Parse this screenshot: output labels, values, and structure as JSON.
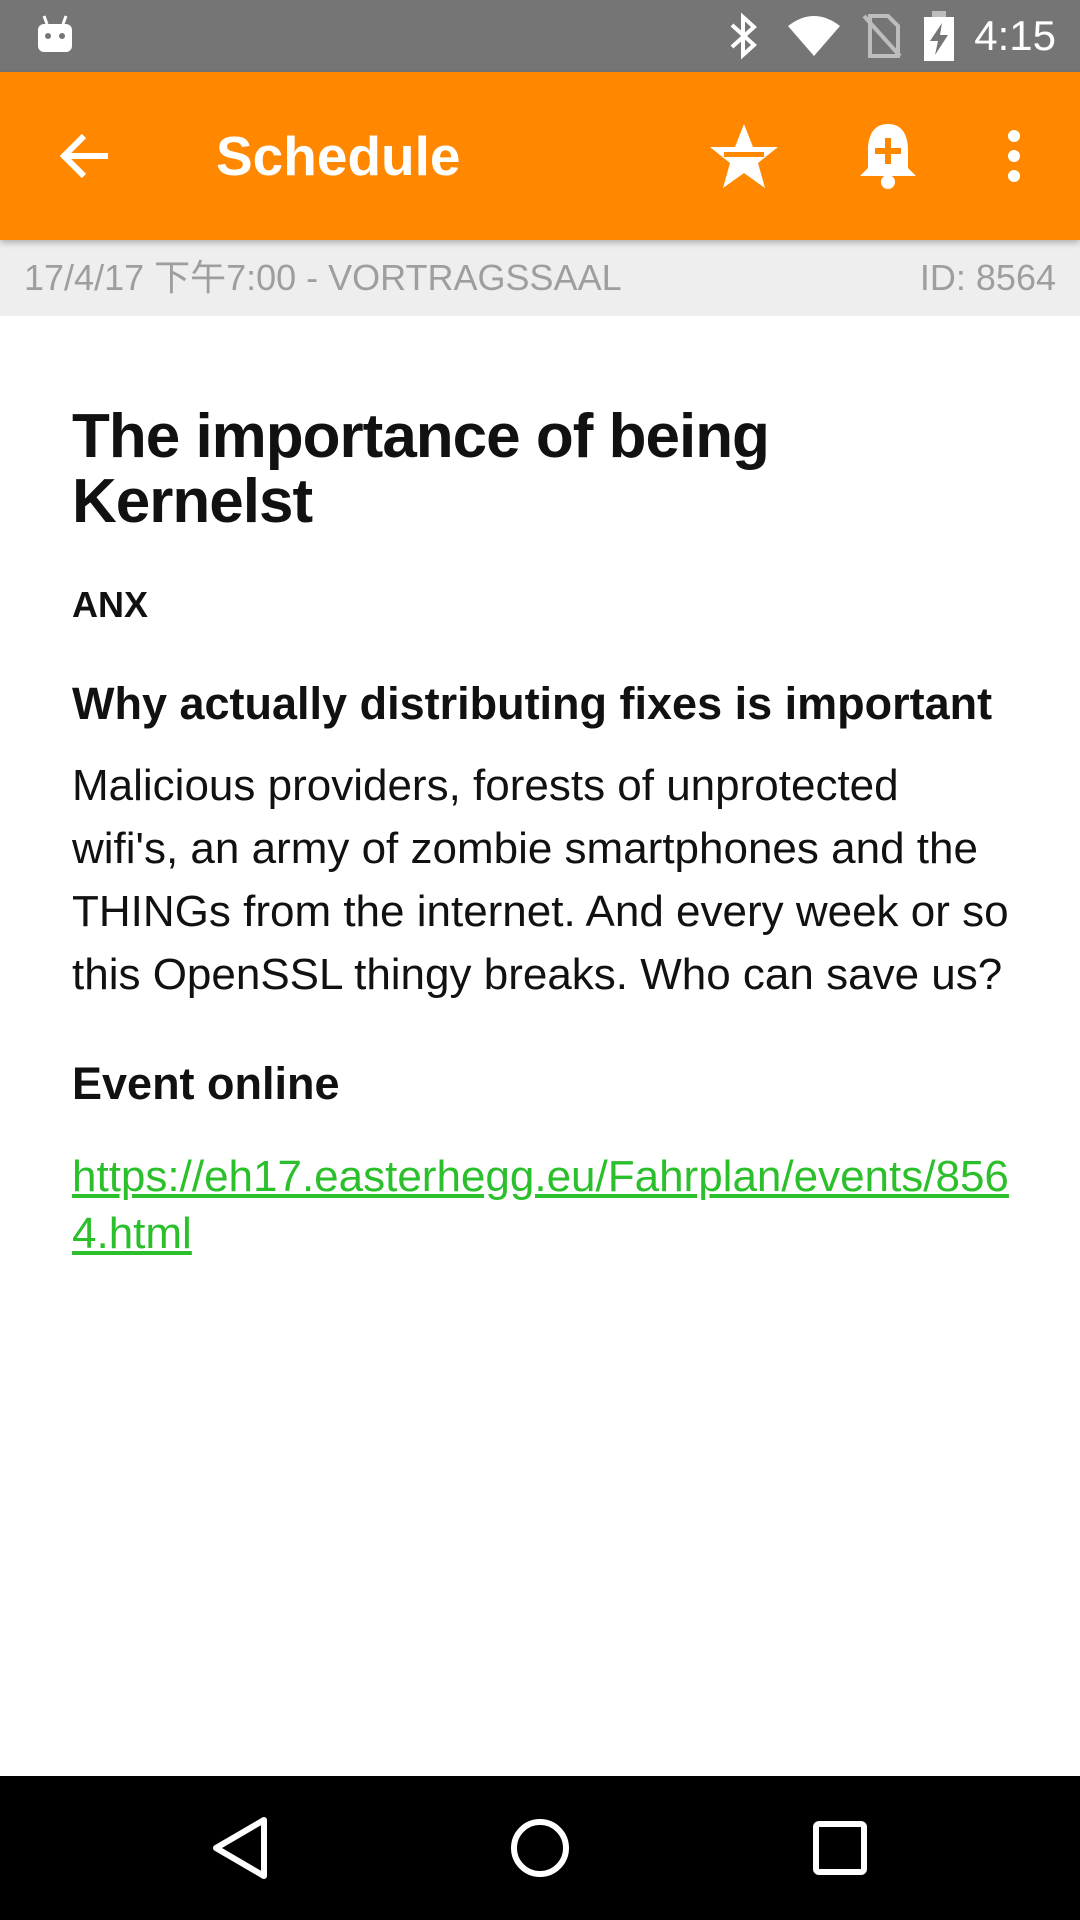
{
  "status_bar": {
    "time": "4:15",
    "icons": [
      "android-icon",
      "bluetooth-icon",
      "wifi-icon",
      "no-sim-icon",
      "battery-charging-icon"
    ]
  },
  "app_bar": {
    "title": "Schedule",
    "back_icon": "arrow-back-icon",
    "actions": [
      "star-icon",
      "add-alarm-icon",
      "more-vert-icon"
    ]
  },
  "meta": {
    "when_where": "17/4/17 下午7:00 - VORTRAGSSAAL",
    "id": "ID: 8564"
  },
  "event": {
    "title": "The importance of being Kernelst",
    "speaker": "ANX",
    "subtitle": "Why actually distributing fixes is important",
    "abstract": "Malicious providers, forests of unprotected wifi's, an army of zombie smartphones and the THINGs from the internet. And every week or so this OpenSSL thingy breaks. Who can save us?",
    "online_heading": "Event online",
    "link": "https://eh17.easterhegg.eu/Fahrplan/events/8564.html"
  },
  "nav_bar": [
    "back-triangle-icon",
    "home-circle-icon",
    "recents-square-icon"
  ],
  "colors": {
    "accent": "#ff8800",
    "link": "#2cbf2c",
    "status_bar": "#757575",
    "meta_bg": "#eeeeee"
  }
}
